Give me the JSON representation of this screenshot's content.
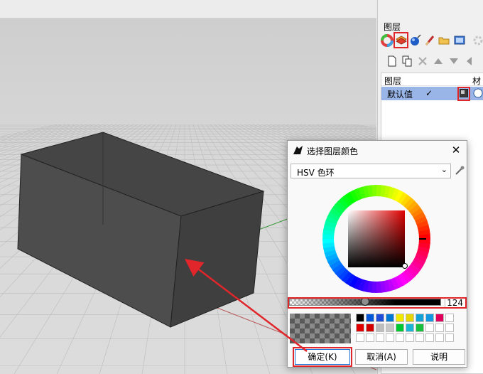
{
  "panel": {
    "title": "图层",
    "columns": {
      "name": "图层",
      "material": "材"
    },
    "layers": [
      {
        "name": "默认值",
        "current": "✓"
      }
    ],
    "tab_icons": [
      "color-wheel-icon",
      "layers-icon",
      "render-icon",
      "brush-icon",
      "folder-icon",
      "display-icon"
    ],
    "toolbar_icons": [
      "new-layer-icon",
      "copy-icon",
      "delete-icon",
      "move-up-icon",
      "move-down-icon",
      "left-icon"
    ]
  },
  "dialog": {
    "title": "选择图层颜色",
    "close": "✕",
    "mode": "HSV 色环",
    "alpha_value": "124",
    "alpha_fraction": 0.5,
    "buttons": {
      "ok": "确定(K)",
      "cancel": "取消(A)",
      "help": "说明"
    },
    "swatches_row1": [
      "#000000",
      "#0057d8",
      "#1e4ed8",
      "#0078d4",
      "#f2e800",
      "#e6d600",
      "#16a0d8",
      "#1397e0",
      "#e0005c",
      "#ffffff"
    ],
    "swatches_row2": [
      "#e00000",
      "#d40000",
      "#bdbdbd",
      "#c8c8c8",
      "#00c830",
      "#1ab4d4",
      "#18c040",
      "#ffffff",
      "#ffffff",
      "#ffffff"
    ]
  },
  "colors": {
    "selection": "#99b4e6",
    "highlight": "#e0262b",
    "object": "#4a4a4a"
  }
}
